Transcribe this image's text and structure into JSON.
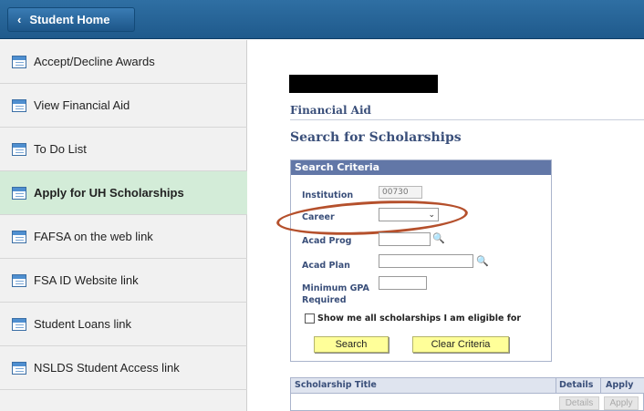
{
  "header": {
    "home_label": "Student Home",
    "back_glyph": "‹"
  },
  "sidebar": {
    "items": [
      {
        "label": "Accept/Decline Awards"
      },
      {
        "label": "View Financial Aid"
      },
      {
        "label": "To Do List"
      },
      {
        "label": "Apply for UH Scholarships",
        "active": true
      },
      {
        "label": "FAFSA on the web link"
      },
      {
        "label": "FSA ID Website link"
      },
      {
        "label": "Student Loans link"
      },
      {
        "label": "NSLDS Student Access link"
      }
    ]
  },
  "main": {
    "section_title": "Financial Aid",
    "page_title": "Search for Scholarships",
    "criteria": {
      "header": "Search Criteria",
      "institution_label": "Institution",
      "institution_value": "00730",
      "career_label": "Career",
      "career_value": "",
      "acad_prog_label": "Acad Prog",
      "acad_plan_label": "Acad Plan",
      "min_gpa_label_1": "Minimum GPA",
      "min_gpa_label_2": "Required",
      "eligible_label": "Show me all scholarships I am eligible for",
      "search_label": "Search",
      "clear_label": "Clear Criteria"
    },
    "grid": {
      "col_title": "Scholarship Title",
      "col_details": "Details",
      "col_apply": "Apply",
      "details_btn": "Details",
      "apply_btn": "Apply"
    }
  },
  "colors": {
    "accent": "#1f5a8c",
    "active_bg": "#d3ecd8",
    "button_yellow": "#ffff99",
    "annotation": "#b5502c"
  }
}
